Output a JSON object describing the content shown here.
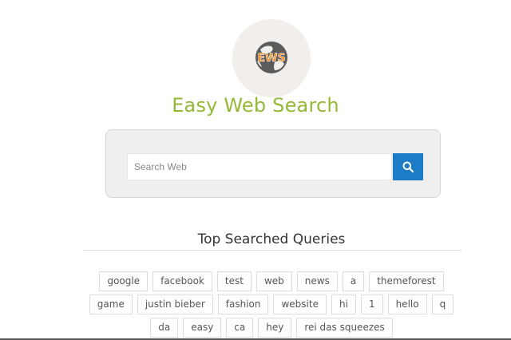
{
  "logo": {
    "text": "EWS",
    "icon": "globe-icon"
  },
  "site_title": "Easy Web Search",
  "search": {
    "placeholder": "Search Web",
    "value": "",
    "button_icon": "search-icon"
  },
  "section_title": "Top Searched Queries",
  "queries": [
    "google",
    "facebook",
    "test",
    "web",
    "news",
    "a",
    "themeforest",
    "game",
    "justin bieber",
    "fashion",
    "website",
    "hi",
    "1",
    "hello",
    "q",
    "da",
    "easy",
    "ca",
    "hey",
    "rei das squeezes"
  ],
  "colors": {
    "title_green": "#94b836",
    "button_blue": "#1c7cc6",
    "logo_orange": "#f08a1c"
  }
}
